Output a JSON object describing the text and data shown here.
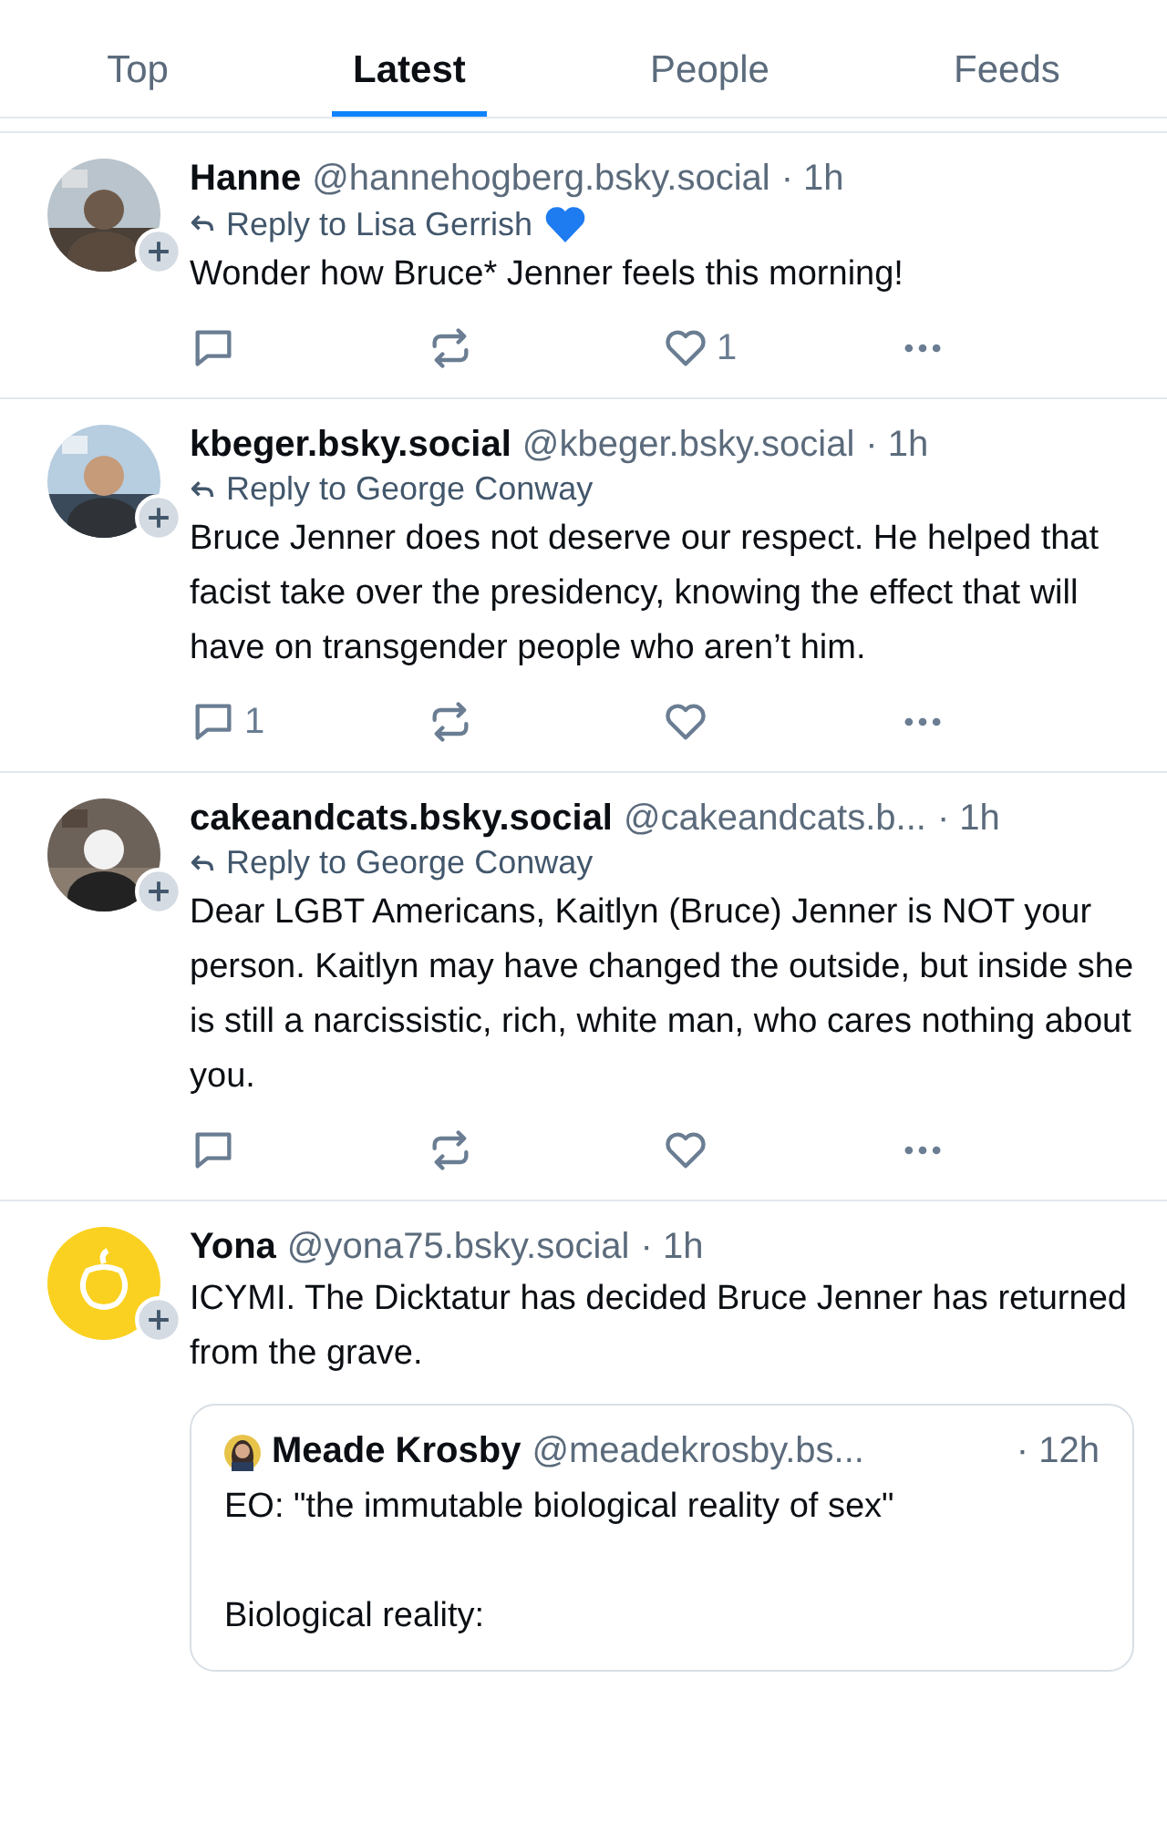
{
  "tabs": [
    {
      "label": "Top",
      "selected": false
    },
    {
      "label": "Latest",
      "selected": true
    },
    {
      "label": "People",
      "selected": false
    },
    {
      "label": "Feeds",
      "selected": false
    }
  ],
  "posts": [
    {
      "name": "Hanne",
      "handle": "@hannehogberg.bsky.social",
      "time": "· 1h",
      "reply_to": "Reply to Lisa Gerrish",
      "reply_heart": true,
      "text": "Wonder how Bruce* Jenner feels this morning!",
      "like_count": "1"
    },
    {
      "name": "kbeger.bsky.social",
      "handle": "@kbeger.bsky.social",
      "time": "· 1h",
      "reply_to": "Reply to George Conway",
      "reply_heart": false,
      "text": "Bruce Jenner does not deserve our respect. He helped that facist take over the presidency, knowing the effect that will have on transgender people who aren’t him.",
      "reply_count": "1"
    },
    {
      "name": "cakeandcats.bsky.social",
      "handle": "@cakeandcats.b...",
      "time": "· 1h",
      "reply_to": "Reply to George Conway",
      "reply_heart": false,
      "text": "Dear LGBT Americans,  Kaitlyn (Bruce) Jenner is NOT your person.  Kaitlyn may have changed the outside, but inside she is still a narcissistic, rich, white man, who cares nothing about you."
    },
    {
      "avatar": {
        "kind": "apple",
        "color": "#fad120"
      },
      "name": "Yona",
      "handle": "@yona75.bsky.social",
      "time": "· 1h",
      "text": "ICYMI. The Dicktatur has decided Bruce Jenner has returned from the grave.",
      "quote": {
        "name": "Meade Krosby",
        "handle": "@meadekrosby.bs...",
        "time": "· 12h",
        "text": "EO: \"the immutable biological reality of sex\"\n\nBiological reality:"
      }
    }
  ]
}
